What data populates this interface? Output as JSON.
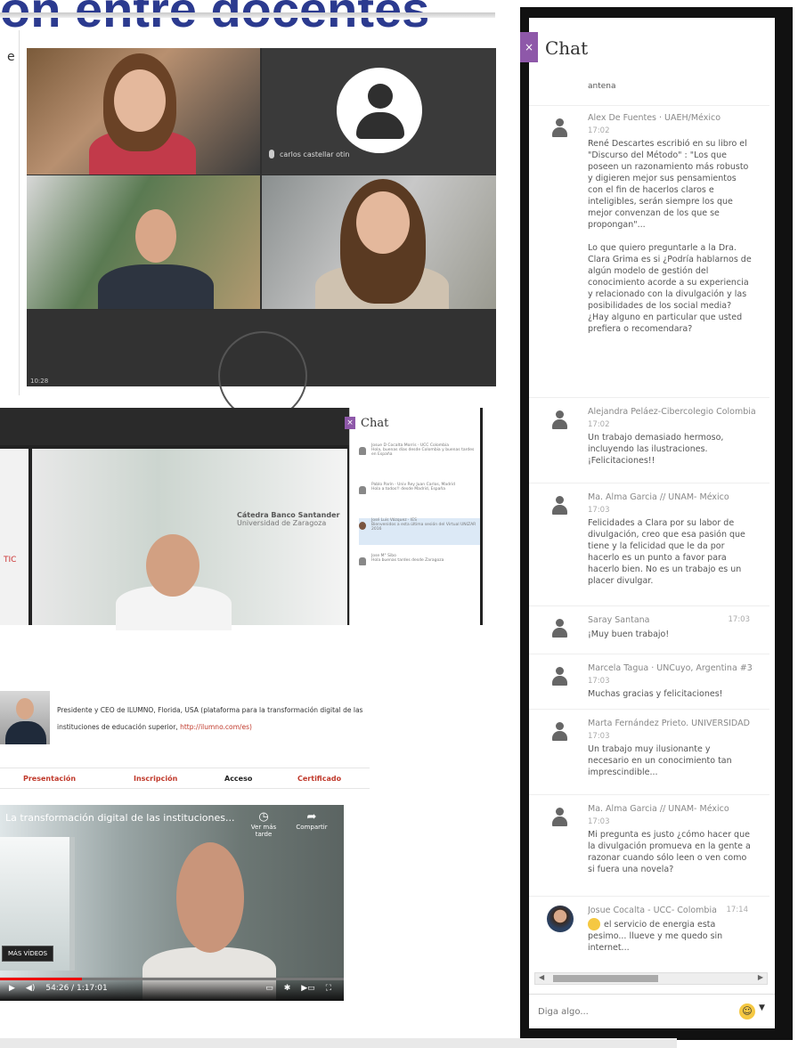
{
  "slide": {
    "title": "ón entre docentes"
  },
  "meet": {
    "participant_name": "carlos castellar otin",
    "timestamp": "10:28"
  },
  "mini_chat": {
    "title": "Chat",
    "messages": [
      {
        "author": "Josue D Cocalta Morris · UCC Colombia",
        "text": "Hola, buenas días desde Colombia y buenas tardes en España"
      },
      {
        "author": "Pablo Parín · Univ Rey Juan Carlos, Madrid",
        "text": "Hola a todos!! desde Madrid, España"
      },
      {
        "author": "José Luis Vázquez · IES",
        "text": "Bienvenidos a esta última sesión del Virtual UNIZAR 2016"
      },
      {
        "author": "Jose M° Sibo",
        "text": "Hola buenas tardes desde Zaragoza"
      }
    ]
  },
  "sc2": {
    "poster_title": "Cátedra Banco Santander",
    "poster_sub": "Universidad de Zaragoza",
    "side_label": "TIC"
  },
  "profile": {
    "text": "Presidente y CEO de ILUMNO, Florida, USA (plataforma para la transformación digital de las instituciones de educación superior,",
    "link": "http://ilumno.com/es)"
  },
  "tabs": [
    "Presentación",
    "Inscripción",
    "Acceso",
    "Certificado"
  ],
  "youtube": {
    "title": "La transformación digital de las instituciones...",
    "watch_later": "Ver más tarde",
    "share": "Compartir",
    "more_videos": "MÁS VÍDEOS",
    "time": "54:26 / 1:17:01"
  },
  "chat": {
    "title": "Chat",
    "top_fragment": "antena",
    "placeholder": "Diga algo...",
    "messages": [
      {
        "author": "Alex De Fuentes · UAEH/México",
        "time": "17:02",
        "text": "René Descartes escribió en su libro el \"Discurso del Método\" : \"Los que poseen un razonamiento más robusto y digieren mejor sus pensamientos con el fin de hacerlos claros e inteligibles, serán siempre los que mejor convenzan de los que se propongan\"...\n\nLo que quiero preguntarle a la Dra. Clara Grima es si ¿Podría hablarnos de algún modelo de gestión del conocimiento acorde a su experiencia y relacionado con la divulgación y las posibilidades de los social media? ¿Hay alguno en particular que usted prefiera o recomendara?"
      },
      {
        "author": "Alejandra Peláez-Cibercolegio Colombia",
        "time": "17:02",
        "text": "Un trabajo demasiado hermoso, incluyendo las ilustraciones. ¡Felicitaciones!!"
      },
      {
        "author": "Ma. Alma Garcia // UNAM- México",
        "time": "17:03",
        "text": "Felicidades a Clara por su labor de divulgación, creo que esa pasión que tiene y la felicidad que le da por hacerlo es un punto a favor para hacerlo bien. No es un trabajo es un placer divulgar."
      },
      {
        "author": "Saray Santana",
        "time": "17:03",
        "text": "¡Muy buen trabajo!"
      },
      {
        "author": "Marcela Tagua · UNCuyo, Argentina #3",
        "time": "17:03",
        "text": "Muchas gracias y felicitaciones!"
      },
      {
        "author": "Marta Fernández Prieto. UNIVERSIDAD",
        "time": "17:03",
        "text": "Un trabajo muy ilusionante y necesario en un conocimiento tan imprescindible..."
      },
      {
        "author": "Ma. Alma Garcia // UNAM- México",
        "time": "17:03",
        "text": "Mi pregunta es justo ¿cómo hacer que la divulgación promueva en la gente a razonar cuando sólo leen o ven como si fuera una novela?"
      },
      {
        "author": "Josue Cocalta - UCC- Colombia",
        "time": "17:14",
        "text": "el servicio de energia esta pesimo... llueve y me quedo sin internet..."
      }
    ]
  }
}
